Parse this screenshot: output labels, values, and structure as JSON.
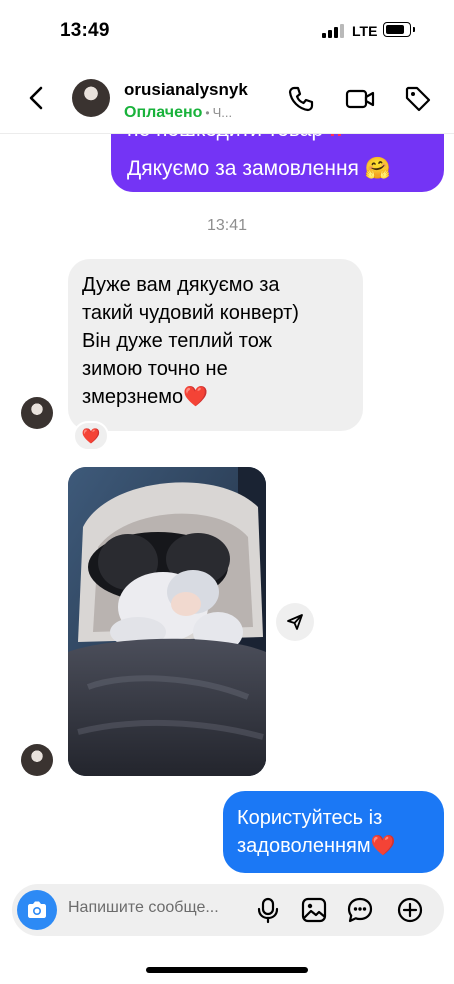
{
  "status_bar": {
    "time": "13:49",
    "network": "LTE",
    "battery_level": 0.85
  },
  "header": {
    "username": "orusianalysnyk",
    "status": "Оплачено",
    "status_separator": "•",
    "status_extra": "Ч...",
    "icons": [
      "back-icon",
      "phone-icon",
      "video-icon",
      "tag-icon"
    ],
    "status_color": "#19b23b"
  },
  "messages": {
    "outgoing_1": {
      "line1": "не пошкодити товар",
      "line1_emoji": "!!",
      "line2": "Дякуємо за замовлення 🤗",
      "color": "#7434f5"
    },
    "timestamp": "13:41",
    "incoming_1": {
      "lines": [
        "Дуже вам дякуємо за",
        "такий чудовий конверт)",
        "Він дуже теплий тож",
        "зимою точно не",
        "змерзнемо❤️"
      ],
      "reaction": "❤️"
    },
    "incoming_photo": {
      "description_icon": "photo-baby-in-stroller"
    },
    "outgoing_2": {
      "lines": [
        "Користуйтесь із",
        "задоволенням❤️"
      ],
      "color": "#1b78f5"
    }
  },
  "composer": {
    "placeholder": "Напишите сообще...",
    "icons": [
      "camera-icon",
      "microphone-icon",
      "gallery-icon",
      "sticker-icon",
      "plus-icon"
    ]
  }
}
